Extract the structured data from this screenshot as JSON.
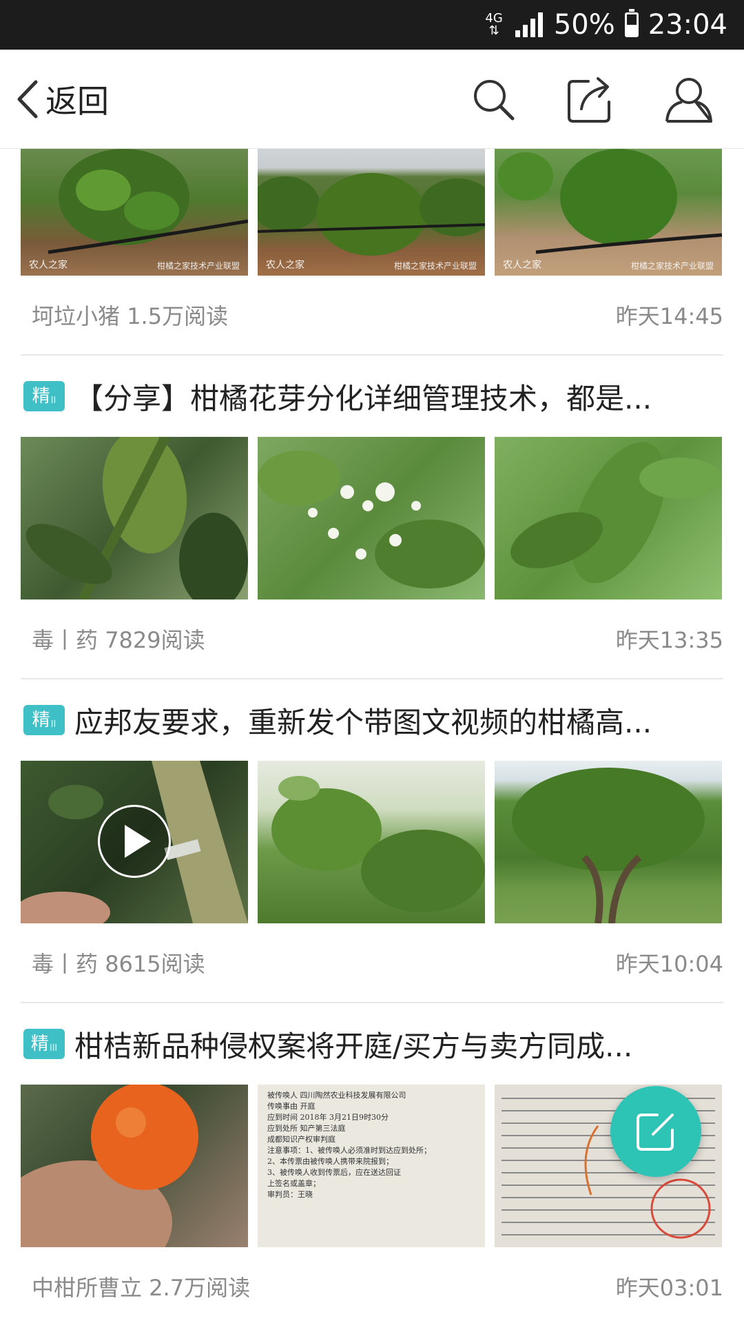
{
  "status_bar": {
    "network": "4G",
    "battery": "50%",
    "battery_level": 0.5,
    "time": "23:04"
  },
  "app_bar": {
    "back_label": "返回"
  },
  "posts": [
    {
      "author": "坷垃小猪",
      "reads": "1.5万阅读",
      "time": "昨天14:45"
    },
    {
      "badge": "精",
      "badge_level": "II",
      "title": "【分享】柑橘花芽分化详细管理技术，都是...",
      "author": "毒丨药",
      "reads": "7829阅读",
      "time": "昨天13:35"
    },
    {
      "badge": "精",
      "badge_level": "II",
      "title": "应邦友要求，重新发个带图文视频的柑橘高...",
      "author": "毒丨药",
      "reads": "8615阅读",
      "time": "昨天10:04"
    },
    {
      "badge": "精",
      "badge_level": "III",
      "title": "柑桔新品种侵权案将开庭/买方与卖方同成...",
      "author": "中柑所曹立",
      "reads": "2.7万阅读",
      "time": "昨天03:01"
    }
  ],
  "watermarks": {
    "left": "农人之家",
    "right": "柑橘之家技术产业联盟"
  },
  "doc_lines": [
    "被传唤人    四川陶然农业科技发展有限公司",
    "传唤事由    开庭",
    "应到时间    2018年 3月21日9时30分",
    "应到处所    知产第三法庭",
    "成都知识产权审判庭",
    "注意事项：1、被传唤人必须准时到达应到处所；",
    "2、本传票由被传唤人携带来院报到；",
    "3、被传唤人收到传票后，应在送达回证",
    "上签名或盖章；",
    "审判员：王晓"
  ],
  "colors": {
    "accent": "#3fbfc6",
    "fab": "#2dc3b5"
  }
}
